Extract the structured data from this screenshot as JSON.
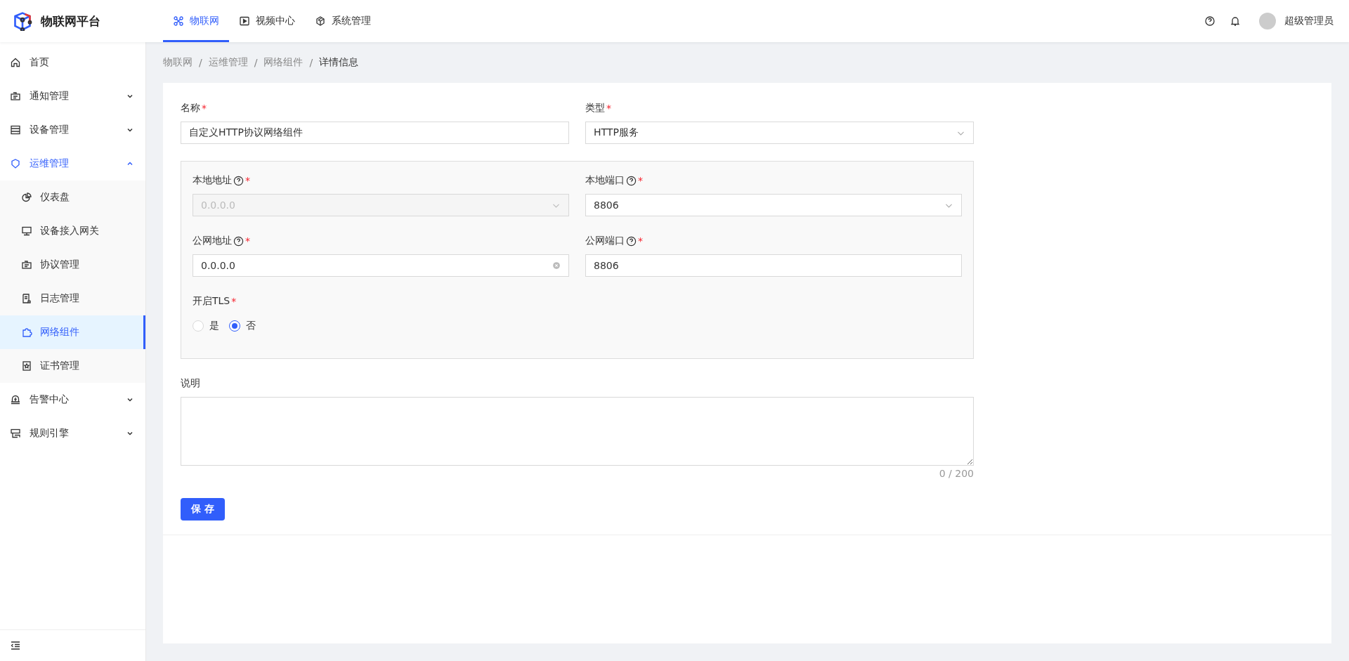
{
  "brand": {
    "title": "物联网平台"
  },
  "top_nav": [
    {
      "label": "物联网",
      "selected": true
    },
    {
      "label": "视频中心",
      "selected": false
    },
    {
      "label": "系统管理",
      "selected": false
    }
  ],
  "user": {
    "name": "超级管理员"
  },
  "sidebar": {
    "items": [
      {
        "label": "首页",
        "selected": false
      },
      {
        "label": "通知管理",
        "expanded": false
      },
      {
        "label": "设备管理",
        "expanded": false
      },
      {
        "label": "运维管理",
        "expanded": true,
        "children": [
          {
            "label": "仪表盘",
            "selected": false
          },
          {
            "label": "设备接入网关",
            "selected": false
          },
          {
            "label": "协议管理",
            "selected": false
          },
          {
            "label": "日志管理",
            "selected": false
          },
          {
            "label": "网络组件",
            "selected": true
          },
          {
            "label": "证书管理",
            "selected": false
          }
        ]
      },
      {
        "label": "告警中心",
        "expanded": false
      },
      {
        "label": "规则引擎",
        "expanded": false
      }
    ]
  },
  "breadcrumb": {
    "items": [
      "物联网",
      "运维管理",
      "网络组件",
      "详情信息"
    ],
    "separators": [
      "/",
      "/",
      "/"
    ]
  },
  "form": {
    "fields": [
      {
        "kind": "text",
        "label": "名称",
        "required_mark": "*",
        "value": "自定义HTTP协议网络组件"
      },
      {
        "kind": "select",
        "label": "类型",
        "required_mark": "*",
        "value": "HTTP服务"
      }
    ],
    "group": {
      "fields": [
        {
          "kind": "select",
          "label": "本地地址",
          "required_mark": "*",
          "value": "0.0.0.0",
          "disabled": true
        },
        {
          "kind": "select",
          "label": "本地端口",
          "required_mark": "*",
          "value": "8806",
          "disabled": false
        },
        {
          "kind": "text",
          "label": "公网地址",
          "required_mark": "*",
          "value": "0.0.0.0",
          "clearable": true
        },
        {
          "kind": "text",
          "label": "公网端口",
          "required_mark": "*",
          "value": "8806",
          "clearable": false
        }
      ],
      "tls": {
        "label": "开启TLS",
        "required_mark": "*",
        "options": [
          {
            "label": "是",
            "selected": false
          },
          {
            "label": "否",
            "selected": true
          }
        ]
      }
    },
    "description": {
      "label": "说明",
      "counter": "0 / 200"
    },
    "save_button": "保 存"
  }
}
